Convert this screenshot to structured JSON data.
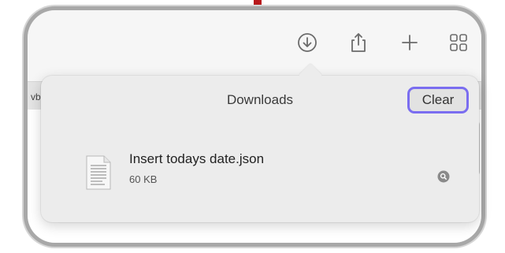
{
  "toolbar": {
    "icons": [
      "downloads-icon",
      "share-icon",
      "new-tab-icon",
      "tab-overview-icon"
    ]
  },
  "tab_strip": {
    "partial_tab_text": "vb"
  },
  "downloads": {
    "title": "Downloads",
    "clear_label": "Clear",
    "items": [
      {
        "name": "Insert todays date.json",
        "size": "60 KB",
        "icon": "document-icon"
      }
    ]
  },
  "colors": {
    "focus_ring": "#7a6df0",
    "marker": "#b8191c"
  }
}
